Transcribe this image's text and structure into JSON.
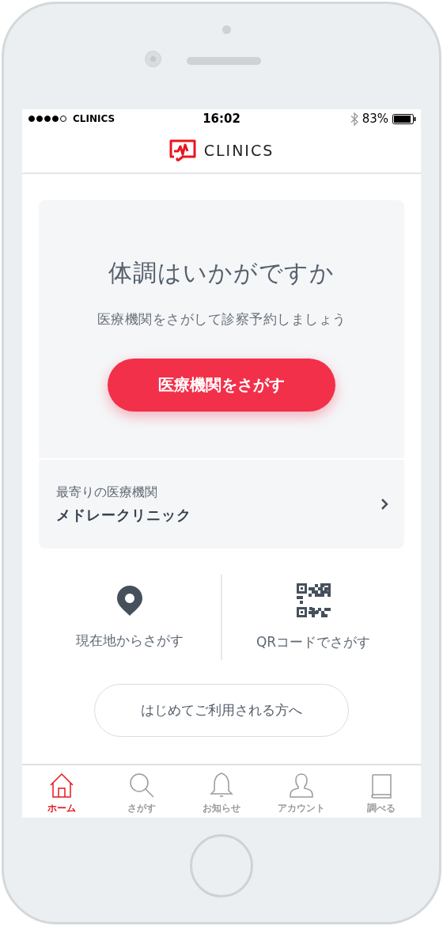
{
  "status_bar": {
    "carrier": "CLINICS",
    "time": "16:02",
    "battery": "83%"
  },
  "header": {
    "logo_text": "CLINICS"
  },
  "hero": {
    "title": "体調はいかがですか",
    "subtitle": "医療機関をさがして診察予約しましょう",
    "button": "医療機関をさがす"
  },
  "nearest": {
    "label": "最寄りの医療機関",
    "name": "メドレークリニック"
  },
  "search_options": [
    {
      "kind": "location",
      "label": "現在地からさがす"
    },
    {
      "kind": "qr",
      "label": "QRコードでさがす"
    }
  ],
  "first_time_button": "はじめてご利用される方へ",
  "tab_bar": [
    {
      "kind": "home",
      "label": "ホーム",
      "selected": true
    },
    {
      "kind": "search",
      "label": "さがす",
      "selected": false
    },
    {
      "kind": "bell",
      "label": "お知らせ",
      "selected": false
    },
    {
      "kind": "account",
      "label": "アカウント",
      "selected": false
    },
    {
      "kind": "book",
      "label": "調べる",
      "selected": false
    }
  ]
}
